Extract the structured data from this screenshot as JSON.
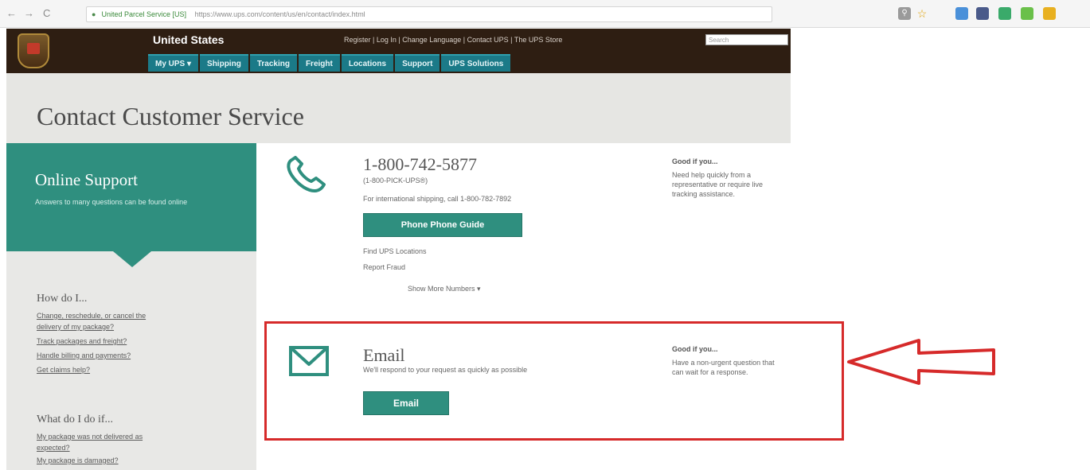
{
  "browser": {
    "back": "←",
    "forward": "→",
    "reload": "C",
    "site_identity": "United Parcel Service [US]",
    "url": "https://www.ups.com/content/us/en/contact/index.html"
  },
  "header": {
    "country": "United States",
    "utility_links": "Register | Log In | Change Language | Contact UPS | The UPS Store",
    "search_placeholder": "Search",
    "tabs": [
      "My UPS ▾",
      "Shipping",
      "Tracking",
      "Freight",
      "Locations",
      "Support",
      "UPS Solutions"
    ]
  },
  "page": {
    "title": "Contact Customer Service"
  },
  "sidebar": {
    "support_title": "Online Support",
    "support_desc": "Answers to many questions can be found online",
    "how_do_i": "How do I...",
    "how_links": [
      "Change, reschedule, or cancel the",
      "delivery of my package?",
      "Track packages and freight?",
      "Handle billing and payments?",
      "Get claims help?"
    ],
    "what_do_i_do": "What do I do if...",
    "what_links": [
      "My package was not delivered as",
      "expected?",
      "My package is damaged?"
    ]
  },
  "phone": {
    "number": "1-800-742-5877",
    "letters": "(1-800-PICK-UPS®)",
    "international": "For international shipping, call 1-800-782-7892",
    "button": "Phone Phone Guide",
    "line1": "Find UPS Locations",
    "line2": "Report Fraud",
    "more": "Show More Numbers ▾",
    "good_heading": "Good if you...",
    "good_text": "Need help quickly from a representative or require live tracking assistance."
  },
  "email": {
    "title": "Email",
    "desc": "We'll respond to your request as quickly as possible",
    "button": "Email",
    "good_heading": "Good if you...",
    "good_text": "Have a non-urgent question that can wait for a response."
  },
  "colors": {
    "brand_brown": "#2e1e12",
    "teal": "#2f8f7f",
    "annotation_red": "#d62a2a"
  },
  "icons": [
    "phone-icon",
    "envelope-icon",
    "lock-icon",
    "star-icon"
  ]
}
